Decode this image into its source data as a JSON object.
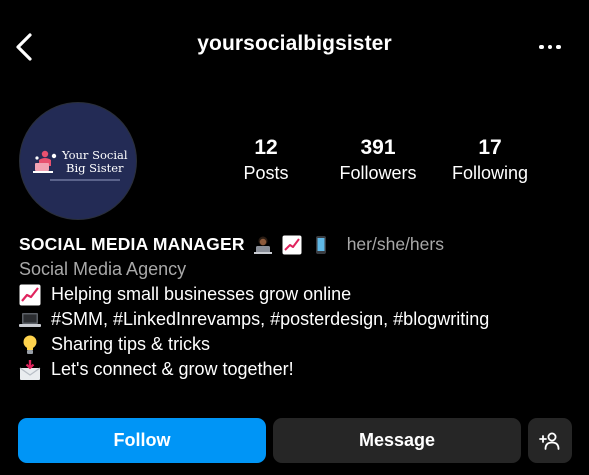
{
  "header": {
    "username": "yoursocialbigsister",
    "back_icon": "chevron-left-icon",
    "more_icon": "more-horizontal-icon"
  },
  "avatar": {
    "line1": "Your Social",
    "line2": "Big Sister",
    "background": "#232b55"
  },
  "stats": [
    {
      "value": "12",
      "label": "Posts"
    },
    {
      "value": "391",
      "label": "Followers"
    },
    {
      "value": "17",
      "label": "Following"
    }
  ],
  "bio": {
    "name": "SOCIAL MEDIA MANAGER",
    "name_emojis": [
      "woman-technologist-emoji",
      "chart-increasing-emoji",
      "mobile-phone-emoji"
    ],
    "pronouns": "her/she/hers",
    "category": "Social Media Agency",
    "lines": [
      {
        "icon": "chart-increasing-emoji",
        "text": "Helping small businesses grow online"
      },
      {
        "icon": "laptop-emoji",
        "text": "#SMM, #LinkedInrevamps, #posterdesign, #blogwriting"
      },
      {
        "icon": "light-bulb-emoji",
        "text": "Sharing tips & tricks"
      },
      {
        "icon": "envelope-with-arrow-emoji",
        "text": "Let's connect & grow together!"
      }
    ]
  },
  "actions": {
    "follow_label": "Follow",
    "message_label": "Message",
    "add_user_icon": "add-person-icon"
  },
  "colors": {
    "background": "#000000",
    "primary_button": "#0095f6",
    "secondary_button": "#262626",
    "muted_text": "#a8a8a8"
  }
}
